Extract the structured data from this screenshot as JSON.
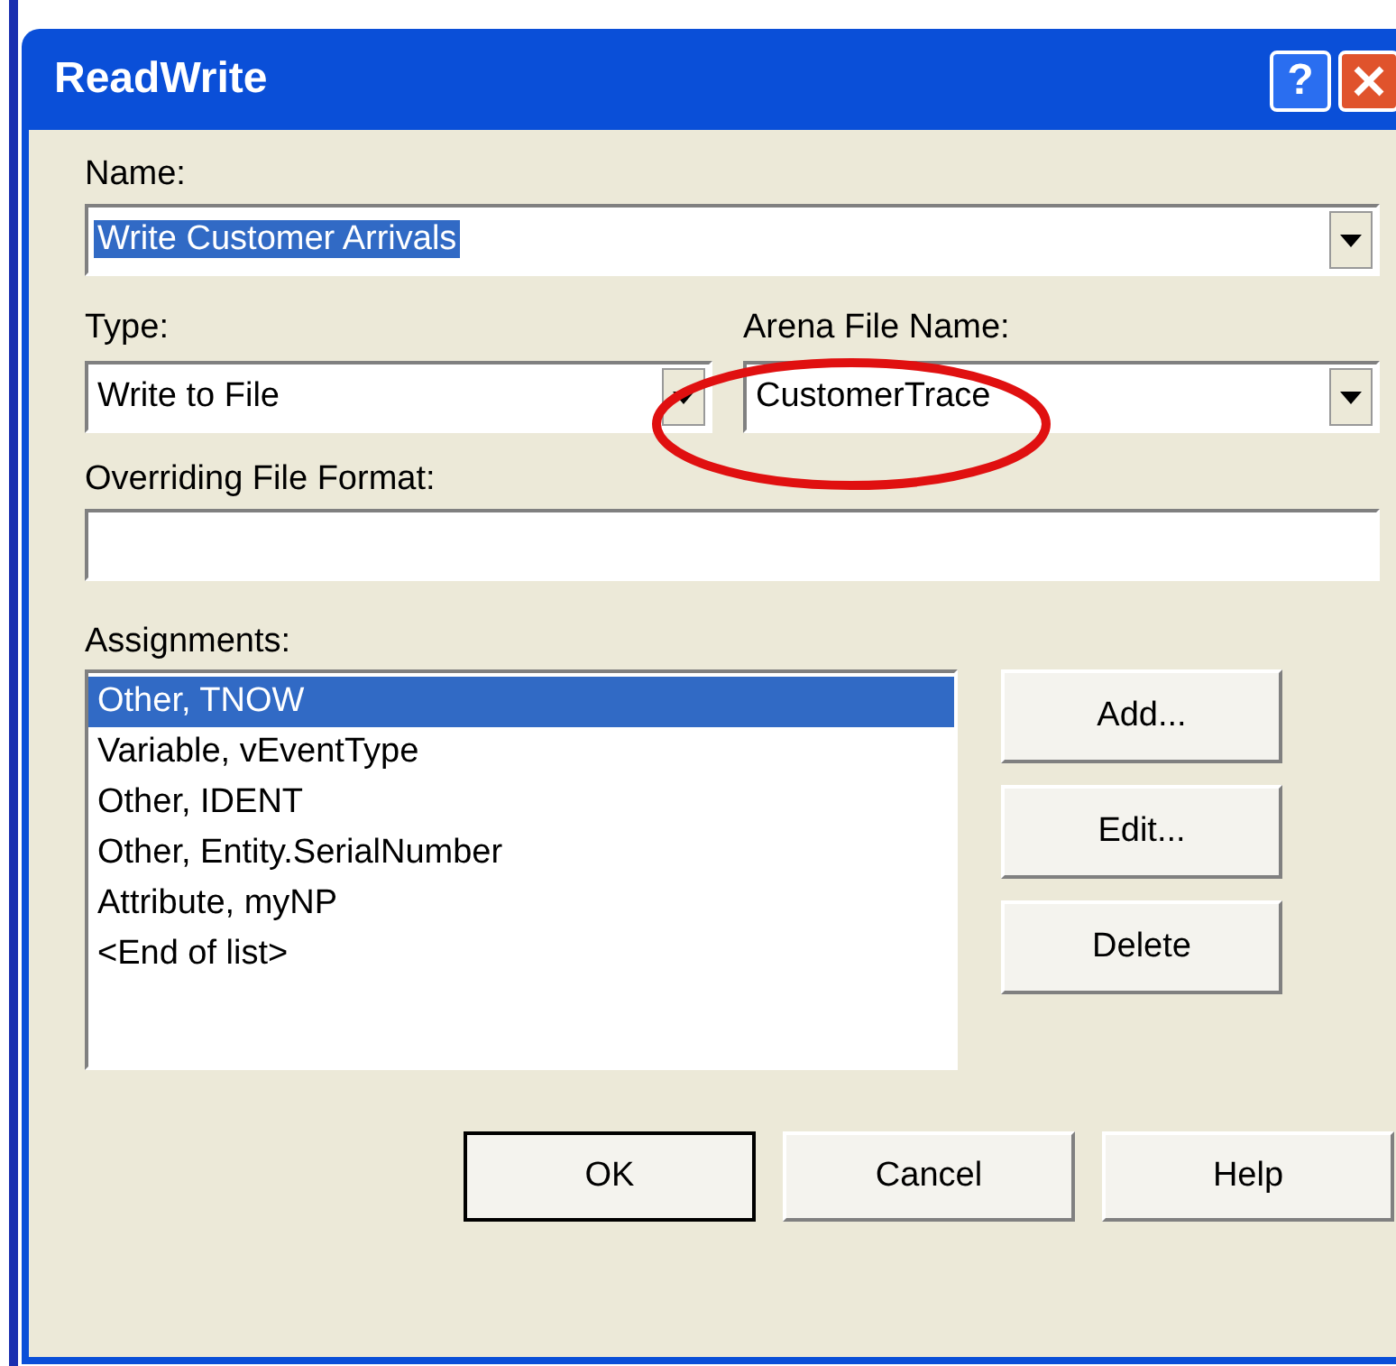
{
  "window": {
    "title": "ReadWrite",
    "help_button": "?"
  },
  "name": {
    "label": "Name:",
    "value": "Write Customer Arrivals",
    "highlighted": true
  },
  "type": {
    "label": "Type:",
    "value": "Write to File"
  },
  "arena_file_name": {
    "label": "Arena File Name:",
    "value": "CustomerTrace"
  },
  "overriding_file_format": {
    "label": "Overriding File Format:"
  },
  "assignments": {
    "label": "Assignments:",
    "items": [
      {
        "text": "Other, TNOW",
        "selected": true
      },
      {
        "text": "Variable, vEventType",
        "selected": false
      },
      {
        "text": "Other, IDENT",
        "selected": false
      },
      {
        "text": "Other, Entity.SerialNumber",
        "selected": false
      },
      {
        "text": "Attribute, myNP",
        "selected": false
      },
      {
        "text": "<End of list>",
        "selected": false
      }
    ]
  },
  "side_buttons": [
    "Add...",
    "Edit...",
    "Delete"
  ],
  "buttons": [
    {
      "label": "OK",
      "default": true
    },
    {
      "label": "Cancel",
      "default": false
    },
    {
      "label": "Help",
      "default": false
    }
  ]
}
